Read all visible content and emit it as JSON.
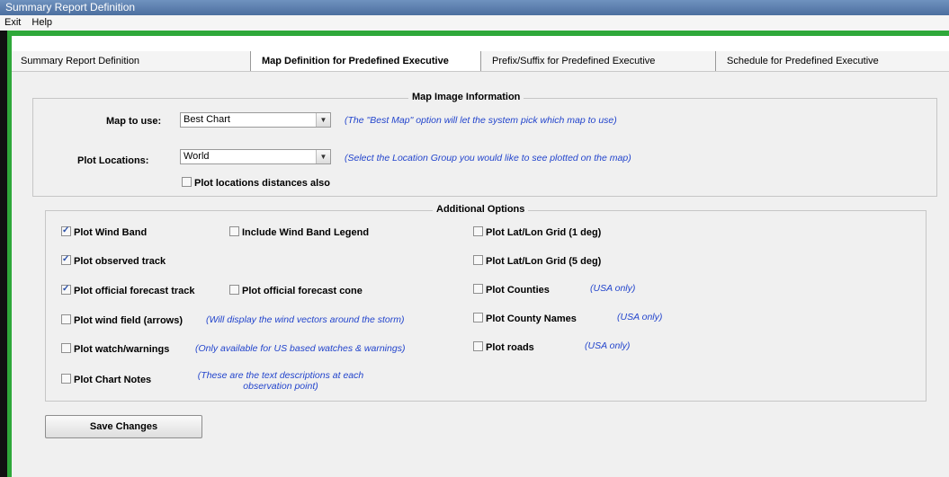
{
  "window": {
    "title": "Summary Report Definition"
  },
  "menu": {
    "items": [
      "Exit",
      "Help"
    ]
  },
  "tabs": [
    {
      "label": "Summary Report Definition"
    },
    {
      "label": "Map Definition for Predefined Executive"
    },
    {
      "label": "Prefix/Suffix for Predefined Executive"
    },
    {
      "label": "Schedule for Predefined Executive"
    }
  ],
  "map_group": {
    "title": "Map Image Information",
    "map_label": "Map to use:",
    "map_value": "Best Chart",
    "map_hint": "(The \"Best Map\" option will let the system pick which map to use)",
    "plot_label": "Plot Locations:",
    "plot_value": "World",
    "plot_hint": "(Select the Location Group you would like to see plotted on the map)",
    "distances_label": "Plot locations distances also"
  },
  "options_group": {
    "title": "Additional Options",
    "wind_band": "Plot Wind Band",
    "wind_legend": "Include Wind Band Legend",
    "latlon1": "Plot Lat/Lon Grid (1 deg)",
    "observed": "Plot observed track",
    "latlon5": "Plot Lat/Lon Grid (5 deg)",
    "forecast_track": "Plot official forecast track",
    "forecast_cone": "Plot official forecast cone",
    "counties": "Plot Counties",
    "counties_hint": "(USA only)",
    "wind_field": "Plot wind field (arrows)",
    "wind_field_hint": "(Will display the wind vectors around the storm)",
    "county_names": "Plot County Names",
    "county_names_hint": "(USA only)",
    "watch": "Plot watch/warnings",
    "watch_hint": "(Only available for US based watches & warnings)",
    "roads": "Plot roads",
    "roads_hint": "(USA only)",
    "notes": "Plot Chart Notes",
    "notes_hint_1": "(These are the text descriptions at each",
    "notes_hint_2": "observation point)"
  },
  "save_label": "Save Changes"
}
